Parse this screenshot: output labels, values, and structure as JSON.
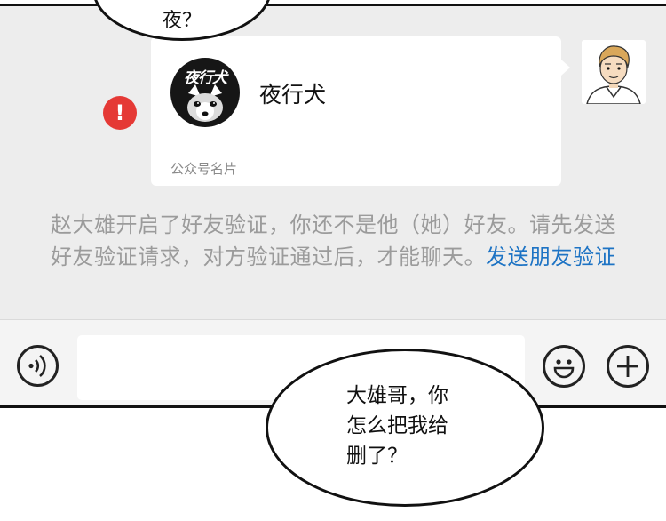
{
  "comic": {
    "top_bubble_text": "夜？",
    "speech_bubble_lines": [
      "大雄哥，你",
      "怎么把我给",
      "删了？"
    ]
  },
  "chat": {
    "card": {
      "logo_text": "夜行犬",
      "name": "夜行犬",
      "type_label": "公众号名片"
    },
    "send_failed_icon": "exclamation-icon",
    "notice_text": "赵大雄开启了好友验证，你还不是他（她）好友。请先发送好友验证请求，对方验证通过后，才能聊天。",
    "notice_link": "发送朋友验证"
  },
  "input_bar": {
    "voice_icon": "voice-icon",
    "input_value": "",
    "emoji_icon": "emoji-icon",
    "plus_icon": "plus-icon"
  },
  "colors": {
    "panel_background": "#ededed",
    "link_blue": "#1d73c4",
    "warning_red": "#e53935",
    "notice_gray": "#9b9b9b"
  }
}
